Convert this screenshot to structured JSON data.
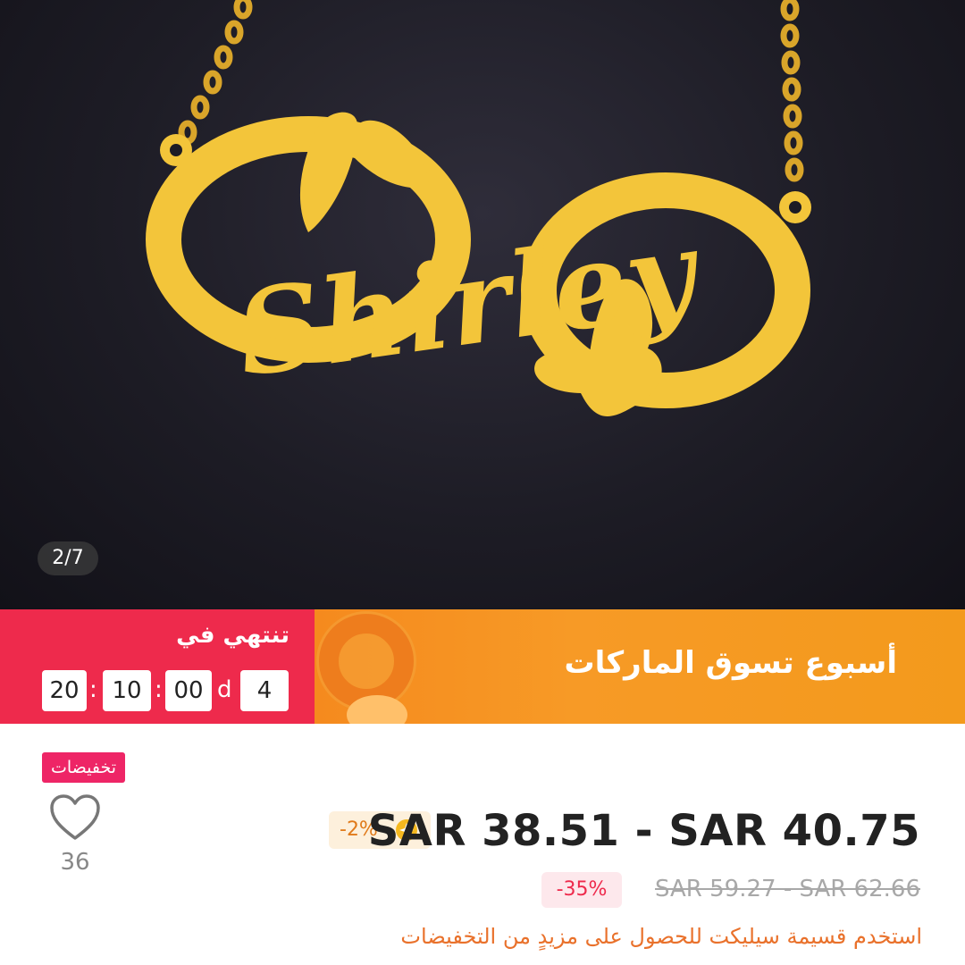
{
  "gallery": {
    "pendant_text": "Shirley",
    "page_indicator": "2/7"
  },
  "banner": {
    "ends_label": "تنتهي في",
    "countdown": {
      "days": "4",
      "days_unit": "d",
      "hours": "00",
      "minutes": "10",
      "seconds": "20",
      "separator": ":"
    },
    "title": "أسبوع تسوق الماركات",
    "colors": {
      "left": "#ee2a4c",
      "right": "#f79a26"
    }
  },
  "product": {
    "sale_tag": "تخفيضات",
    "wish_count": "36",
    "price_range": "SAR 38.51 - SAR 40.75",
    "coin_discount": "-2%",
    "discount_percent": "-35%",
    "original_price_range": "SAR 59.27 - SAR 62.66",
    "coupon_note": "استخدم قسيمة سيليكت للحصول على مزيدٍ من التخفيضات"
  },
  "icons": [
    "heart-icon",
    "coin-icon",
    "brand-logo-icon"
  ]
}
